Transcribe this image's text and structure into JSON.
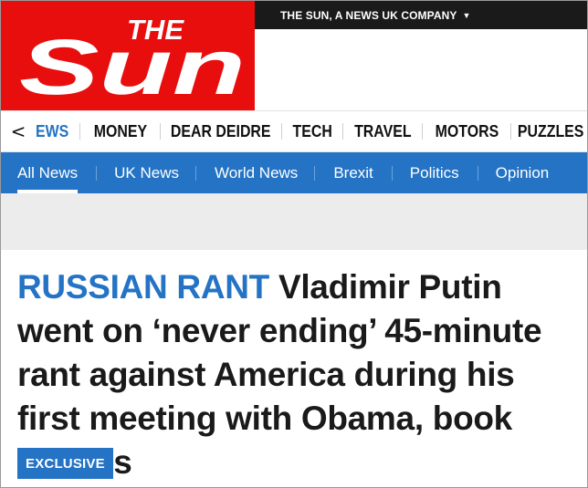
{
  "brand": {
    "logo_text_small": "THE",
    "logo_text_large": "Sun",
    "logo_color": "#e90e0e",
    "company_line": "THE SUN, A NEWS UK COMPANY",
    "company_caret": "▼"
  },
  "section_nav": {
    "back_icon": "chevron-left-icon",
    "back_glyph": "<",
    "items": [
      "EWS",
      "MONEY",
      "DEAR DEIDRE",
      "TECH",
      "TRAVEL",
      "MOTORS",
      "PUZZLES"
    ]
  },
  "sub_nav": {
    "color": "#2473c5",
    "active": "All News",
    "items": [
      "All News",
      "UK News",
      "World News",
      "Brexit",
      "Politics",
      "Opinion"
    ]
  },
  "article": {
    "kicker": "RUSSIAN RANT",
    "headline": "Vladimir Putin went on ‘never ending’ 45-minute rant against America during his first meeting with Obama, book reveals",
    "badge": "EXCLUSIVE"
  }
}
